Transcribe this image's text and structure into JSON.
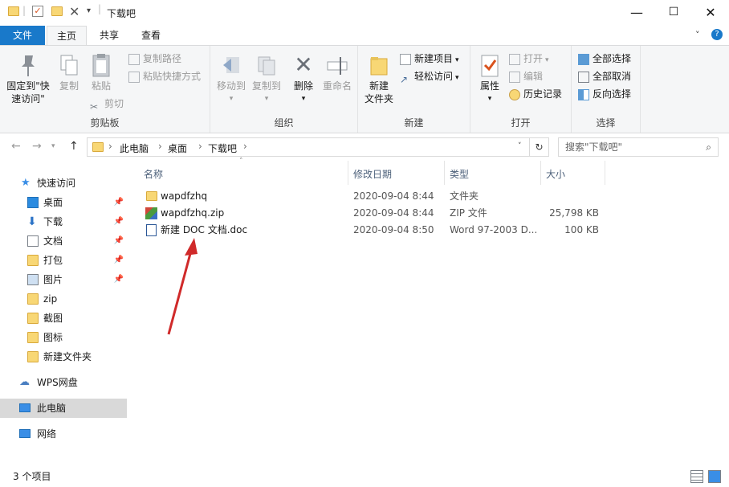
{
  "window": {
    "title": "下载吧",
    "controls": [
      "—",
      "☐",
      "✕"
    ]
  },
  "ribbon_tabs": [
    {
      "label": "文件"
    },
    {
      "label": "主页"
    },
    {
      "label": "共享"
    },
    {
      "label": "查看"
    }
  ],
  "ribbon": {
    "clipboard": {
      "label": "剪贴板",
      "pin_quick_access": "固定到\"快\n速访问\"",
      "pin_line1": "固定到\"快",
      "pin_line2": "速访问\"",
      "copy": "复制",
      "paste": "粘贴",
      "copy_path": "复制路径",
      "paste_shortcut": "粘贴快捷方式",
      "cut": "剪切"
    },
    "organize": {
      "label": "组织",
      "move_to": "移动到",
      "copy_to": "复制到",
      "delete": "删除",
      "rename": "重命名"
    },
    "new": {
      "label": "新建",
      "new_folder_line1": "新建",
      "new_folder_line2": "文件夹",
      "new_item": "新建项目",
      "easy_access": "轻松访问"
    },
    "open": {
      "label": "打开",
      "properties": "属性",
      "open": "打开",
      "edit": "编辑",
      "history": "历史记录"
    },
    "select": {
      "label": "选择",
      "select_all": "全部选择",
      "select_none": "全部取消",
      "invert": "反向选择"
    }
  },
  "address": {
    "path": [
      "此电脑",
      "桌面",
      "下载吧"
    ],
    "search_placeholder": "搜索\"下载吧\""
  },
  "sidebar": {
    "quick_access": "快速访问",
    "items": [
      {
        "label": "桌面",
        "pinned": true,
        "icon": "desktop-icon"
      },
      {
        "label": "下载",
        "pinned": true,
        "icon": "download-icon"
      },
      {
        "label": "文档",
        "pinned": true,
        "icon": "document-icon"
      },
      {
        "label": "打包",
        "pinned": true,
        "icon": "folder-icon"
      },
      {
        "label": "图片",
        "pinned": true,
        "icon": "pictures-icon"
      },
      {
        "label": "zip",
        "pinned": false,
        "icon": "folder-icon"
      },
      {
        "label": "截图",
        "pinned": false,
        "icon": "folder-icon"
      },
      {
        "label": "图标",
        "pinned": false,
        "icon": "folder-icon"
      },
      {
        "label": "新建文件夹",
        "pinned": false,
        "icon": "folder-icon"
      }
    ],
    "wps": "WPS网盘",
    "this_pc": "此电脑",
    "network": "网络"
  },
  "columns": {
    "name": "名称",
    "date": "修改日期",
    "type": "类型",
    "size": "大小"
  },
  "files": [
    {
      "name": "wapdfzhq",
      "date": "2020-09-04 8:44",
      "type": "文件夹",
      "size": "",
      "icon": "folder-icon"
    },
    {
      "name": "wapdfzhq.zip",
      "date": "2020-09-04 8:44",
      "type": "ZIP 文件",
      "size": "25,798 KB",
      "icon": "zip-icon"
    },
    {
      "name": "新建 DOC 文档.doc",
      "date": "2020-09-04 8:50",
      "type": "Word 97-2003 D...",
      "size": "100 KB",
      "icon": "word-doc-icon"
    }
  ],
  "status": {
    "count": "3 个项目"
  }
}
